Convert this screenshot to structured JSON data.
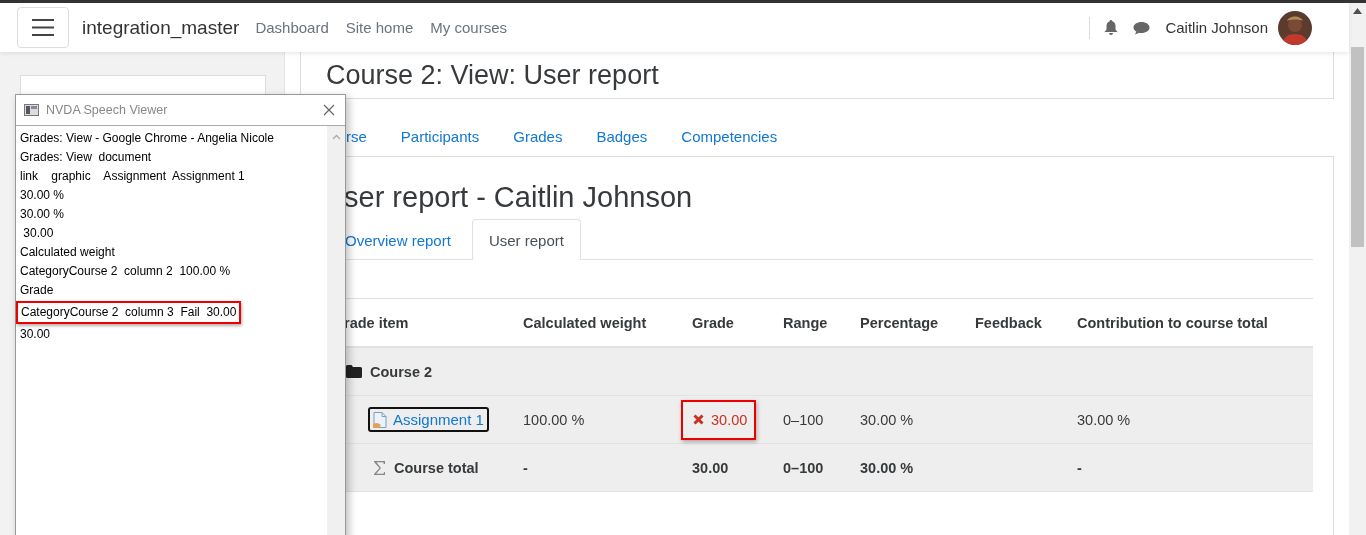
{
  "navbar": {
    "site_name": "integration_master",
    "links": [
      "Dashboard",
      "Site home",
      "My courses"
    ],
    "user_name": "Caitlin Johnson"
  },
  "page_header": {
    "title": "Course 2: View: User report"
  },
  "course_nav": [
    "rse",
    "Participants",
    "Grades",
    "Badges",
    "Competencies"
  ],
  "report": {
    "heading": "ser report - Caitlin Johnson",
    "tabs": [
      {
        "label": "Overview report",
        "selected": false
      },
      {
        "label": "User report",
        "selected": true
      }
    ],
    "table": {
      "columns": [
        "rade item",
        "Calculated weight",
        "Grade",
        "Range",
        "Percentage",
        "Feedback",
        "Contribution to course total"
      ],
      "rows": [
        {
          "kind": "category",
          "item": "Course 2"
        },
        {
          "kind": "item",
          "item": "Assignment 1",
          "focused": true,
          "weight": "100.00 %",
          "grade": "30.00",
          "grade_failed": true,
          "grade_highlighted": true,
          "range": "0–100",
          "percentage": "30.00 %",
          "contribution": "30.00 %"
        },
        {
          "kind": "total",
          "item": "Course total",
          "weight": "-",
          "grade": "30.00",
          "range": "0–100",
          "percentage": "30.00 %",
          "contribution": "-"
        }
      ]
    }
  },
  "speech_viewer": {
    "title": "NVDA Speech Viewer",
    "lines": [
      {
        "text": "Grades: View - Google Chrome - Angelia Nicole",
        "highlighted": false
      },
      {
        "text": "Grades: View  document",
        "highlighted": false
      },
      {
        "text": "link    graphic    Assignment  Assignment 1",
        "highlighted": false
      },
      {
        "text": "30.00 %",
        "highlighted": false
      },
      {
        "text": "30.00 %",
        "highlighted": false
      },
      {
        "text": " 30.00",
        "highlighted": false
      },
      {
        "text": "Calculated weight",
        "highlighted": false
      },
      {
        "text": "CategoryCourse 2  column 2  100.00 %",
        "highlighted": false
      },
      {
        "text": "Grade",
        "highlighted": false
      },
      {
        "text": "CategoryCourse 2  column 3  Fail  30.00",
        "highlighted": true
      },
      {
        "text": "30.00",
        "highlighted": false
      }
    ]
  }
}
